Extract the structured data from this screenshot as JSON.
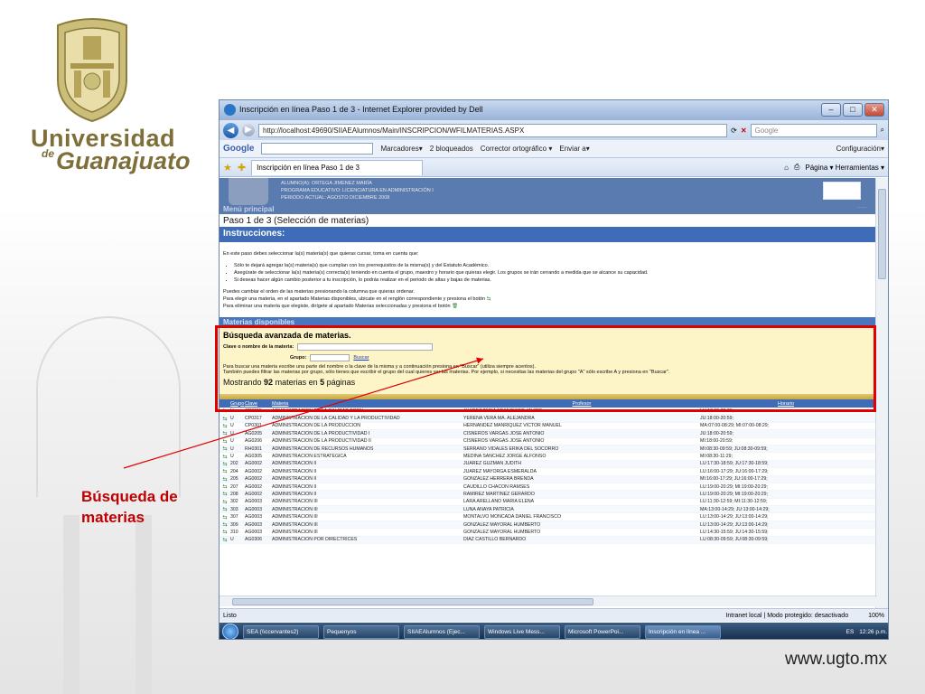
{
  "slide": {
    "logo": {
      "line1": "Universidad",
      "de": "de",
      "line2": "Guanajuato"
    },
    "footer_url": "www.ugto.mx",
    "callout": "Búsqueda de materias"
  },
  "browser": {
    "title": "Inscripción en línea Paso 1 de 3 - Internet Explorer provided by Dell",
    "url": "http://localhost:49690/SIIAEAlumnos/Main/INSCRIPCION/WFILMATERIAS.ASPX",
    "search_placeholder": "Google",
    "google_toolbar": {
      "logo": "Google",
      "items": [
        "Marcadores▾",
        "2 bloqueados",
        "Corrector ortográfico ▾",
        "Enviar a▾"
      ],
      "config": "Configuración▾"
    },
    "tab_label": "Inscripción en línea Paso 1 de 3",
    "tools": "Página ▾   Herramientas ▾",
    "status_left": "Listo",
    "status_zone": "Intranet local | Modo protegido: desactivado",
    "status_zoom": "100%"
  },
  "page": {
    "alumno": "ALUMNO(A): ORTEGA JIMENEZ MARÍA",
    "programa": "PROGRAMA EDUCATIVO: LICENCIATURA EN ADMINISTRACIÓN I",
    "periodo": "PERIODO ACTUAL: AGOSTO DICIEMBRE 2008",
    "menu": "Menú principal",
    "paso": "Paso 1 de 3 (Selección de materias)",
    "instrucciones_title": "Instrucciones:",
    "intro": "En este paso debes seleccionar la(s) materia(s) que quieras cursar, toma en cuenta que:",
    "bullets": [
      "Sólo te dejará agregar la(s) materia(s) que cumplan con los prerrequisitos de la misma(s) y del Estatuto Académico.",
      "Asegúrate de seleccionar la(s) materia(s) correcta(s) teniendo en cuenta el grupo, maestro y horario que quieras elegir. Los grupos se irán cerrando a medida que se alcance su capacidad.",
      "Si deseas hacer algún cambio posterior a tu inscripción, lo podrás realizar en el periodo de altas y bajas de materias."
    ],
    "nota1": "Puedes cambiar el orden de las materias presionando la columna que quieras ordenar.",
    "nota2": "Para elegir una materia, en el apartado Materias disponibles, ubicate en el renglón correspondiente y presiona el botón",
    "nota3": "Para eliminar una materia que elegiste, dirígete al apartado Materias seleccionadas y presiona el botón",
    "materias_disponibles": "Materias disponibles",
    "busqueda_title": "Búsqueda avanzada de materias.",
    "clave_label": "Clave o nombre de la materia:",
    "grupo_label": "Grupo:",
    "buscar": "Buscar",
    "ayuda1": "Para buscar una materia escribe una parte del nombre o la clave de la misma y a continuación presiona en \"Buscar\" (utiliza siempre acentos).",
    "ayuda2": "También puedes filtrar las materias por grupo, sólo tienes que escribir el grupo del cual quieres ver las materias. Por ejemplo, si necesitas las materias del grupo \"A\" sólo escribe A y presiona en \"Buscar\".",
    "mostrando_pre": "Mostrando",
    "mostrando_count": "92",
    "mostrando_mid": "materias en",
    "mostrando_pages": "5",
    "mostrando_post": "páginas",
    "columns": {
      "grupo": "Grupo",
      "clave": "Clave",
      "materia": "Materia",
      "profesor": "Profesor",
      "horario": "Horario"
    },
    "rows": [
      [
        "U",
        "CP0315",
        "ADMINISTRACIÓN DE LA CALIDAD TOTAL",
        "JUÁREZ TAPIA FRANCISCO JAVIER",
        "LU:18:00-20:29;"
      ],
      [
        "U",
        "CP0317",
        "ADMINISTRACIÓN DE LA CALIDAD Y LA PRODUCTIVIDAD",
        "YERENA VERA MA. ALEJANDRA",
        "JU:18:00-20:59;"
      ],
      [
        "U",
        "CP0301",
        "ADMINISTRACIÓN DE LA PRODUCCIÓN",
        "HERNÁNDEZ MANRÍQUEZ VÍCTOR MANUEL",
        "MA:07:00-08:29; MI:07:00-08:29;"
      ],
      [
        "U",
        "AG0205",
        "ADMINISTRACIÓN DE LA PRODUCTIVIDAD I",
        "CISNEROS VARGAS JOSE ANTONIO",
        "JU:18:00-20:59;"
      ],
      [
        "U",
        "AG0206",
        "ADMINISTRACIÓN DE LA PRODUCTIVIDAD II",
        "CISNEROS VARGAS JOSE ANTONIO",
        "MI:18:00-20:59;"
      ],
      [
        "U",
        "RH0301",
        "ADMINISTRACIÓN DE RECURSOS HUMANOS",
        "SERRANO VIDALES ERIKA DEL SOCORRO",
        "MI:08:30-09:59; JU:08:30-09:59;"
      ],
      [
        "U",
        "AG0305",
        "ADMINISTRACIÓN ESTRATÉGICA",
        "MEDINA SANCHEZ JORGE ALFONSO",
        "MI:08:30-11:29;"
      ],
      [
        "202",
        "AG0002",
        "ADMINISTRACIÓN II",
        "JUÁREZ GUZMÁN JUDITH",
        "LU:17:30-18:59; JU:17:30-18:59;"
      ],
      [
        "204",
        "AG0002",
        "ADMINISTRACIÓN II",
        "JUAREZ MAYORGA ESMERALDA",
        "LU:16:00-17:29; JU:16:00-17:29;"
      ],
      [
        "205",
        "AG0002",
        "ADMINISTRACIÓN II",
        "GONZALEZ HERRERA BRENDA",
        "MI:16:00-17:29; JU:16:00-17:29;"
      ],
      [
        "207",
        "AG0002",
        "ADMINISTRACIÓN II",
        "CAUDILLO CHACÓN RAMSÉS",
        "LU:19:00-20:29; MI:19:00-20:29;"
      ],
      [
        "208",
        "AG0002",
        "ADMINISTRACIÓN II",
        "RAMÍREZ MARTÍNEZ GERARDO",
        "LU:19:00-20:29; MI:19:00-20:29;"
      ],
      [
        "302",
        "AG0003",
        "ADMINISTRACIÓN III",
        "LARA ARELLANO MARIA ELENA",
        "LU:11:30-12:59; MI:11:30-12:59;"
      ],
      [
        "303",
        "AG0003",
        "ADMINISTRACIÓN III",
        "LUNA ANAYA PATRICIA",
        "MA:13:00-14:29; JU:13:00-14:29;"
      ],
      [
        "307",
        "AG0003",
        "ADMINISTRACIÓN III",
        "MONTALVO MONCADA DANIEL FRANCISCO",
        "LU:13:00-14:29; JU:13:00-14:29;"
      ],
      [
        "309",
        "AG0003",
        "ADMINISTRACIÓN III",
        "GONZALEZ MAYORAL HUMBERTO",
        "LU:13:00-14:29; JU:13:00-14:29;"
      ],
      [
        "310",
        "AG0003",
        "ADMINISTRACIÓN III",
        "GONZALEZ MAYORAL HUMBERTO",
        "LU:14:30-15:59; JU:14:30-15:59;"
      ],
      [
        "U",
        "AG0306",
        "ADMINISTRACIÓN POR DIRECTRICES",
        "DIAZ CASTILLO BERNARDO",
        "LU:08:30-09:59; JU:08:30-09:59;"
      ]
    ]
  },
  "taskbar": {
    "items": [
      "SEA (\\\\ccervantes2)",
      "Pequenyos",
      "SIIAEAlumnos (Ejec...",
      "Windows Live Mess...",
      "Microsoft PowerPoi...",
      "Inscripción en línea ..."
    ],
    "lang": "ES",
    "clock": "12:26 p.m."
  }
}
